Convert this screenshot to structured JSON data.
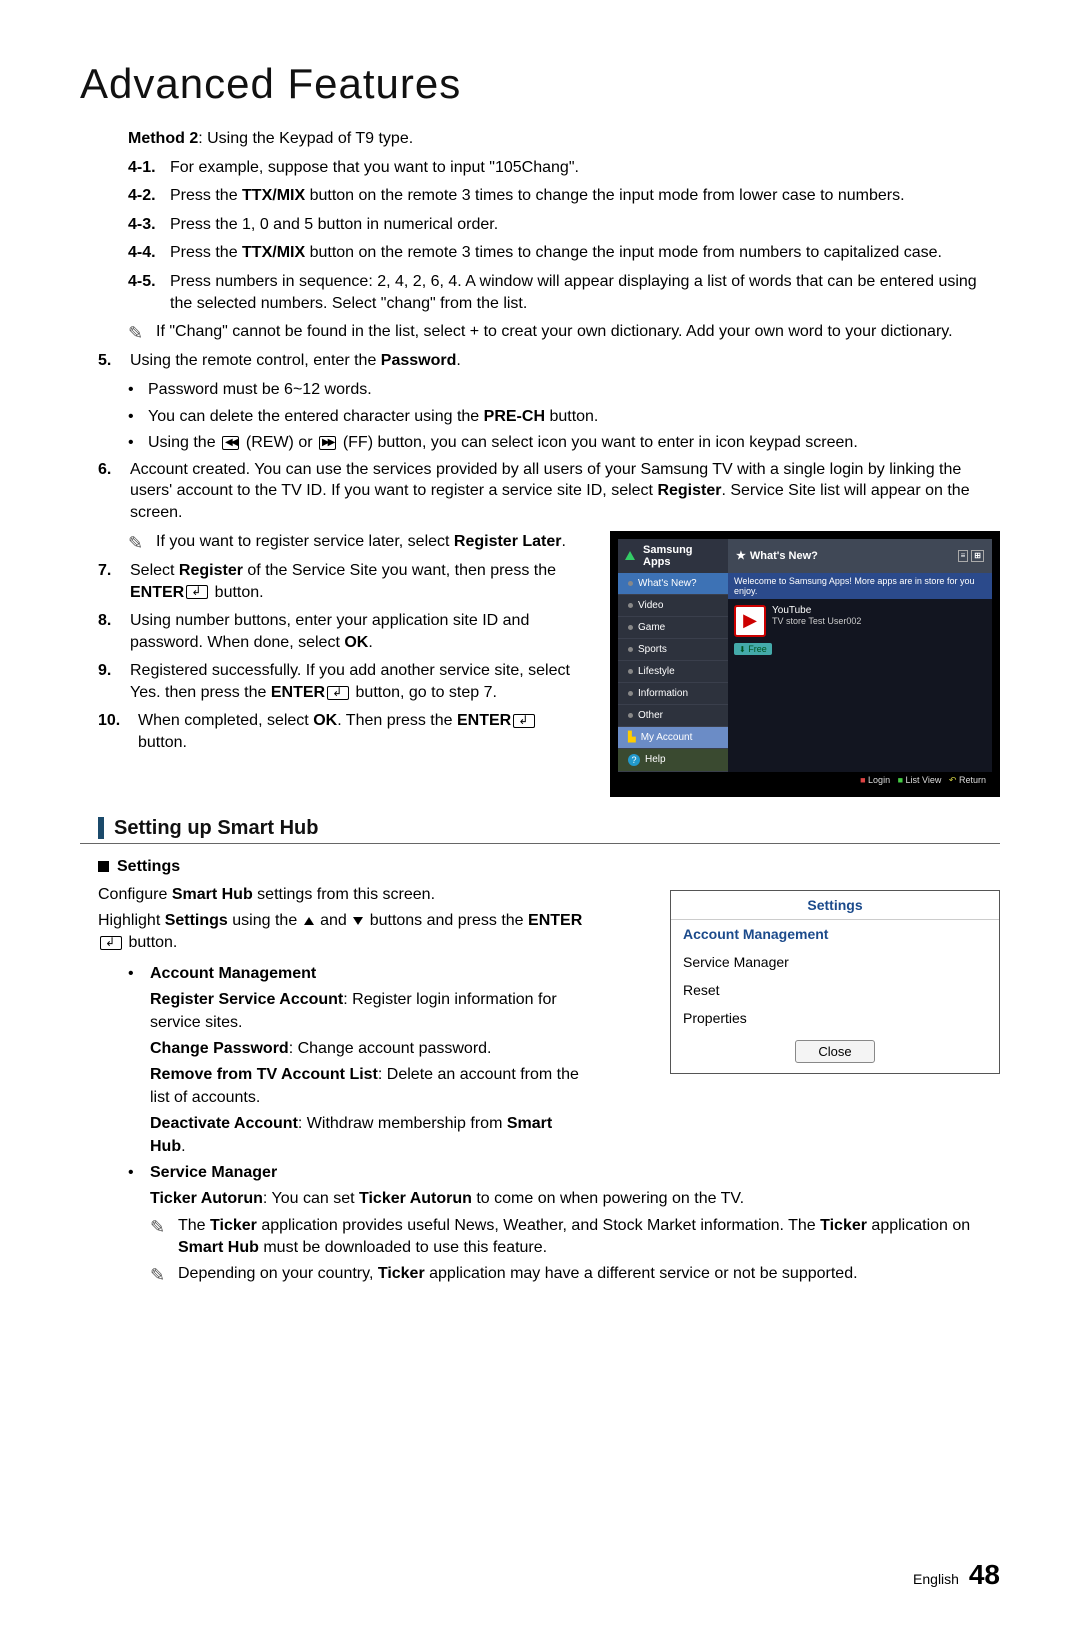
{
  "title": "Advanced Features",
  "method2": "Method 2",
  "method2_desc": ": Using the Keypad of T9 type.",
  "step4_1_num": "4-1.",
  "step4_1": "For example, suppose that you want to input \"105Chang\".",
  "step4_2_num": "4-2.",
  "step4_2a": "Press the ",
  "step4_2b": "TTX/MIX",
  "step4_2c": " button on the remote 3 times to change the input mode from lower case to numbers.",
  "step4_3_num": "4-3.",
  "step4_3": "Press the 1, 0 and 5 button in numerical order.",
  "step4_4_num": "4-4.",
  "step4_4a": "Press the ",
  "step4_4b": "TTX/MIX",
  "step4_4c": " button on the remote 3 times to change the input mode from numbers to capitalized case.",
  "step4_5_num": "4-5.",
  "step4_5": "Press numbers in sequence: 2, 4, 2, 6, 4. A window will appear displaying a list of words that can be entered using the selected numbers. Select \"chang\" from the list.",
  "note4": "If \"Chang\" cannot be found in the list, select + to creat your own dictionary. Add your own word to your dictionary.",
  "step5_num": "5.",
  "step5a": "Using the remote control, enter the ",
  "step5b": "Password",
  "step5c": ".",
  "step5_b1": "Password must be 6~12 words.",
  "step5_b2a": "You can delete the entered character using the ",
  "step5_b2b": "PRE-CH",
  "step5_b2c": " button.",
  "step5_b3a": "Using the ",
  "step5_b3b": " (REW) or ",
  "step5_b3c": " (FF) button, you can select icon you want to enter in icon keypad screen.",
  "step6_num": "6.",
  "step6a": "Account created. You can use the services provided by all users of your Samsung TV with a single login by linking the users' account to the TV ID. If you want to register a service site ID, select ",
  "step6b": "Register",
  "step6c": ". Service Site list will appear on the screen.",
  "note6a": "If you want to register service later, select ",
  "note6b": "Register Later",
  "note6c": ".",
  "step7_num": "7.",
  "step7a": "Select ",
  "step7b": "Register",
  "step7c": " of the Service Site you want, then press the ",
  "step7d": "ENTER",
  "step7e": " button.",
  "step8_num": "8.",
  "step8a": "Using number buttons, enter your application site ID and password. When done, select ",
  "step8b": "OK",
  "step8c": ".",
  "step9_num": "9.",
  "step9a": "Registered successfully. If you add another service site, select Yes. then press the ",
  "step9b": "ENTER",
  "step9c": " button, go to step 7.",
  "step10_num": "10.",
  "step10a": "When completed, select ",
  "step10b": "OK",
  "step10c": ". Then press the ",
  "step10d": "ENTER",
  "step10e": " button.",
  "tv": {
    "side_header": "Samsung Apps",
    "main_header": "What's New?",
    "banner": "Welecome to Samsung Apps! More apps are in store for you enjoy.",
    "side": [
      "What's New?",
      "Video",
      "Game",
      "Sports",
      "Lifestyle",
      "Information",
      "Other",
      "My Account",
      "Help"
    ],
    "tile_l1": "YouTube",
    "tile_l2": "TV store Test User002",
    "free": "Free",
    "footer_login": "Login",
    "footer_list": "List View",
    "footer_return": "Return"
  },
  "section_heading": "Setting up Smart Hub",
  "settings_label": "Settings",
  "cfg_a": "Configure ",
  "cfg_b": "Smart Hub",
  "cfg_c": " settings from this screen.",
  "hl_a": "Highlight ",
  "hl_b": "Settings",
  "hl_c": " using the ",
  "hl_d": " and ",
  "hl_e": " buttons and press the ",
  "hl_f": "ENTER",
  "hl_g": " button.",
  "am_title": "Account Management",
  "am1a": "Register Service Account",
  "am1b": ": Register login information for service sites.",
  "am2a": "Change Password",
  "am2b": ": Change account password.",
  "am3a": "Remove from TV Account List",
  "am3b": ": Delete an account from the list of accounts.",
  "am4a": "Deactivate Account",
  "am4b": ": Withdraw membership from ",
  "am4c": "Smart Hub",
  "am4d": ".",
  "sm_title": "Service Manager",
  "sm1a": "Ticker Autorun",
  "sm1b": ": You can set ",
  "sm1c": "Ticker Autorun",
  "sm1d": " to come on when powering on the TV.",
  "smn1a": "The ",
  "smn1b": "Ticker",
  "smn1c": " application provides useful News, Weather, and Stock Market information. The ",
  "smn1d": "Ticker",
  "smn1e": " application on ",
  "smn1f": "Smart Hub",
  "smn1g": " must be downloaded to use this feature.",
  "smn2a": "Depending on your country, ",
  "smn2b": "Ticker",
  "smn2c": " application may have a different service or not be supported.",
  "dlg": {
    "title": "Settings",
    "items": [
      "Account Management",
      "Service Manager",
      "Reset",
      "Properties"
    ],
    "close": "Close"
  },
  "footer_lang": "English",
  "footer_page": "48"
}
